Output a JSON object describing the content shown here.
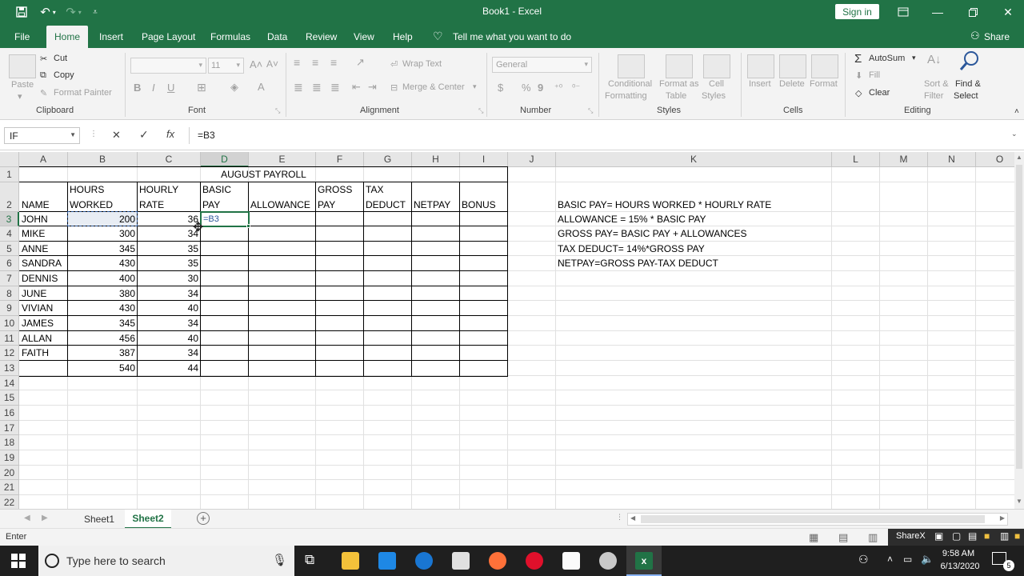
{
  "window": {
    "title": "Book1  -  Excel",
    "sign_in": "Sign in"
  },
  "menu": {
    "tabs": [
      "File",
      "Home",
      "Insert",
      "Page Layout",
      "Formulas",
      "Data",
      "Review",
      "View",
      "Help"
    ],
    "tell_me": "Tell me what you want to do",
    "share": "Share"
  },
  "ribbon": {
    "clipboard": {
      "paste": "Paste",
      "cut": "Cut",
      "copy": "Copy",
      "format_painter": "Format Painter",
      "label": "Clipboard"
    },
    "font": {
      "size": "11",
      "label": "Font",
      "bold": "B",
      "italic": "I",
      "underline": "U"
    },
    "alignment": {
      "wrap_text": "Wrap Text",
      "merge_center": "Merge & Center",
      "label": "Alignment"
    },
    "number": {
      "format": "General",
      "currency": "$",
      "percent": "%",
      "comma": "9",
      "label": "Number"
    },
    "styles": {
      "conditional_1": "Conditional",
      "conditional_2": "Formatting",
      "format_table_1": "Format as",
      "format_table_2": "Table",
      "cell_styles_1": "Cell",
      "cell_styles_2": "Styles",
      "label": "Styles"
    },
    "cells": {
      "insert": "Insert",
      "delete": "Delete",
      "format": "Format",
      "label": "Cells"
    },
    "editing": {
      "autosum": "AutoSum",
      "fill": "Fill",
      "clear": "Clear",
      "sort_1": "Sort &",
      "sort_2": "Filter",
      "find_1": "Find &",
      "find_2": "Select",
      "label": "Editing"
    }
  },
  "formula_bar": {
    "name_box": "IF",
    "cancel": "✕",
    "enter": "✓",
    "fx": "fx",
    "formula": "=B3"
  },
  "grid": {
    "columns": [
      "A",
      "B",
      "C",
      "D",
      "E",
      "F",
      "G",
      "H",
      "I",
      "J",
      "K",
      "L",
      "M",
      "N",
      "O"
    ],
    "rows": [
      "1",
      "2",
      "3",
      "4",
      "5",
      "6",
      "7",
      "8",
      "9",
      "10",
      "11",
      "12",
      "13",
      "14",
      "15",
      "16",
      "17",
      "18",
      "19",
      "20",
      "21",
      "22"
    ],
    "title": "AUGUST PAYROLL",
    "headers_top": {
      "B": "HOURS",
      "C": "HOURLY",
      "D": "BASIC",
      "F": "GROSS",
      "G": "TAX"
    },
    "headers_bottom": {
      "A": "NAME",
      "B": "WORKED",
      "C": "RATE",
      "D": "PAY",
      "E": "ALLOWANCE",
      "F": "PAY",
      "G": "DEDUCT",
      "H": "NETPAY",
      "I": "BONUS"
    },
    "records": [
      {
        "name": "JOHN",
        "hours": "200",
        "rate": "36"
      },
      {
        "name": "MIKE",
        "hours": "300",
        "rate": "34"
      },
      {
        "name": "ANNE",
        "hours": "345",
        "rate": "35"
      },
      {
        "name": "SANDRA",
        "hours": "430",
        "rate": "35"
      },
      {
        "name": "DENNIS",
        "hours": "400",
        "rate": "30"
      },
      {
        "name": "JUNE",
        "hours": "380",
        "rate": "34"
      },
      {
        "name": "VIVIAN",
        "hours": "430",
        "rate": "40"
      },
      {
        "name": "JAMES",
        "hours": "345",
        "rate": "34"
      },
      {
        "name": "ALLAN",
        "hours": "456",
        "rate": "40"
      },
      {
        "name": "FAITH",
        "hours": "387",
        "rate": "34"
      },
      {
        "name": "",
        "hours": "540",
        "rate": "44"
      }
    ],
    "editing_cell": "=B3",
    "notes": [
      "BASIC PAY= HOURS WORKED * HOURLY RATE",
      "ALLOWANCE = 15% * BASIC PAY",
      "GROSS PAY= BASIC PAY + ALLOWANCES",
      "TAX DEDUCT= 14%*GROSS PAY",
      "NETPAY=GROSS PAY-TAX DEDUCT"
    ]
  },
  "sheets": {
    "tabs": [
      "Sheet1",
      "Sheet2"
    ],
    "active": "Sheet2"
  },
  "status": {
    "mode": "Enter",
    "sharex": "ShareX"
  },
  "taskbar": {
    "search_placeholder": "Type here to search",
    "time": "9:58 AM",
    "date": "6/13/2020",
    "notifications": "5"
  },
  "colors": {
    "excel_green": "#217346",
    "selection": "#217346"
  }
}
